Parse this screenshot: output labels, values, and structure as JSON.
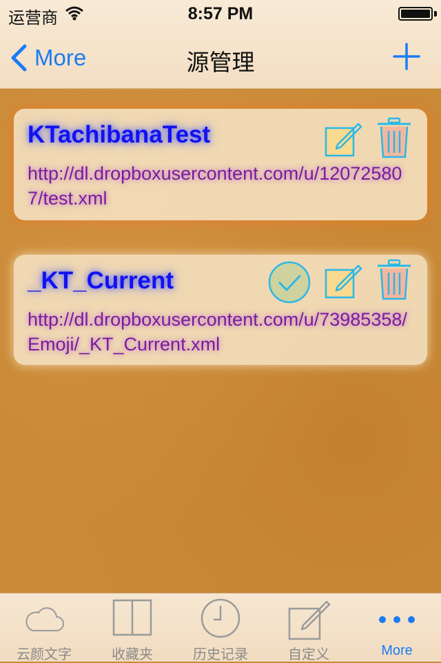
{
  "status_bar": {
    "carrier": "运营商",
    "time": "8:57 PM"
  },
  "nav": {
    "back_label": "More",
    "title": "源管理"
  },
  "sources": [
    {
      "title": "KTachibanaTest",
      "url": "http://dl.dropboxusercontent.com/u/120725807/test.xml",
      "selected": false
    },
    {
      "title": "_KT_Current",
      "url": "http://dl.dropboxusercontent.com/u/73985358/Emoji/_KT_Current.xml",
      "selected": true
    }
  ],
  "tabs": [
    {
      "label": "云颜文字",
      "icon": "cloud-icon",
      "active": false
    },
    {
      "label": "收藏夹",
      "icon": "book-icon",
      "active": false
    },
    {
      "label": "历史记录",
      "icon": "clock-icon",
      "active": false
    },
    {
      "label": "自定义",
      "icon": "compose-icon",
      "active": false
    },
    {
      "label": "More",
      "icon": "more-dots-icon",
      "active": true
    }
  ],
  "colors": {
    "accent": "#1a7cf5",
    "title_text": "#1212ee",
    "url_text": "#7b1c9e",
    "background": "#c98a36"
  }
}
